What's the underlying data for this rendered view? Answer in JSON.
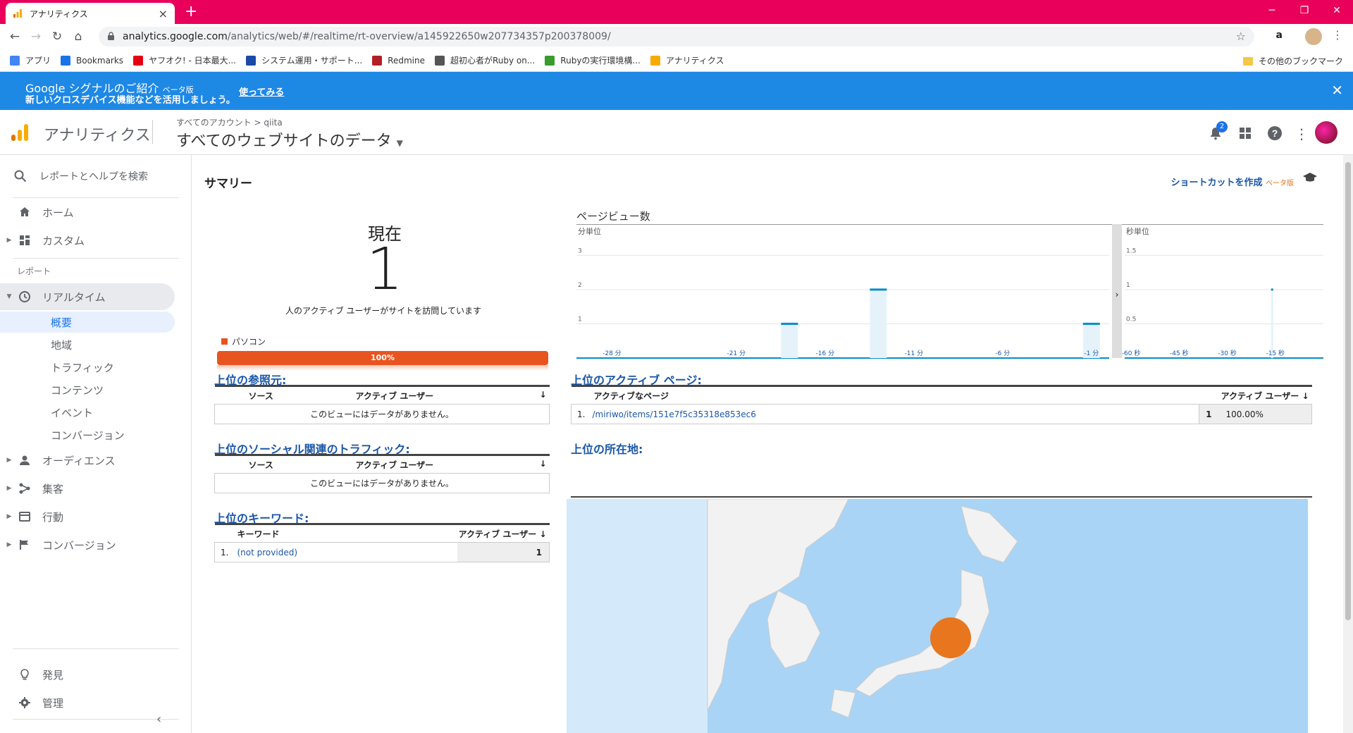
{
  "browser": {
    "tab_title": "アナリティクス",
    "url_host": "analytics.google.com",
    "url_path": "/analytics/web/#/realtime/rt-overview/a145922650w207734357p200378009/",
    "bookmarks": [
      {
        "label": "アプリ",
        "color": "#4285f4"
      },
      {
        "label": "Bookmarks",
        "color": "#1a73e8"
      },
      {
        "label": "ヤフオク! - 日本最大...",
        "color": "#e60012"
      },
      {
        "label": "システム運用・サポート...",
        "color": "#1a4aa8"
      },
      {
        "label": "Redmine",
        "color": "#b32024"
      },
      {
        "label": "超初心者がRuby on...",
        "color": "#555555"
      },
      {
        "label": "Rubyの実行環境構...",
        "color": "#3a9c2c"
      },
      {
        "label": "アナリティクス",
        "color": "#f9ab00"
      }
    ],
    "other_bookmarks": "その他のブックマーク"
  },
  "banner": {
    "title": "Google シグナルのご紹介",
    "beta": "ベータ版",
    "subtitle": "新しいクロスデバイス機能などを活用しましょう。",
    "action": "使ってみる"
  },
  "header": {
    "app_name": "アナリティクス",
    "breadcrumb": "すべてのアカウント > qiita",
    "view_name": "すべてのウェブサイトのデータ",
    "notification_count": "2"
  },
  "sidebar": {
    "search_placeholder": "レポートとヘルプを検索",
    "home": "ホーム",
    "custom": "カスタム",
    "reports_label": "レポート",
    "realtime": "リアルタイム",
    "realtime_sub": [
      "概要",
      "地域",
      "トラフィック",
      "コンテンツ",
      "イベント",
      "コンバージョン"
    ],
    "audience": "オーディエンス",
    "acquisition": "集客",
    "behavior": "行動",
    "conversions": "コンバージョン",
    "discover": "発見",
    "admin": "管理"
  },
  "main": {
    "title": "サマリー",
    "shortcut": "ショートカットを作成",
    "shortcut_beta": "ベータ版",
    "now_label": "現在",
    "now_value": "1",
    "now_desc": "人のアクティブ ユーザーがサイトを訪問しています",
    "device_legend": "パソコン",
    "device_percent": "100%",
    "device_color": "#e8541f",
    "pageviews_title": "ページビュー数",
    "per_minute_label": "分単位",
    "per_second_label": "秒単位",
    "referrers": {
      "title": "上位の参照元:",
      "col1": "ソース",
      "col2": "アクティブ ユーザー",
      "empty": "このビューにはデータがありません。"
    },
    "social": {
      "title": "上位のソーシャル関連のトラフィック:",
      "col1": "ソース",
      "col2": "アクティブ ユーザー",
      "empty": "このビューにはデータがありません。"
    },
    "keywords": {
      "title": "上位のキーワード:",
      "col1": "キーワード",
      "col2": "アクティブ ユーザー",
      "rows": [
        {
          "index": "1.",
          "keyword": "(not provided)",
          "users": "1"
        }
      ]
    },
    "pages": {
      "title": "上位のアクティブ ページ:",
      "col1": "アクティブなページ",
      "col2": "アクティブ ユーザー",
      "rows": [
        {
          "index": "1.",
          "page": "/miriwo/items/151e7f5c35318e853ec6",
          "users": "1",
          "percent": "100.00%"
        }
      ]
    },
    "locations": {
      "title": "上位の所在地:"
    }
  },
  "chart_data": [
    {
      "type": "bar",
      "title": "分単位",
      "x_ticks": [
        "-28 分",
        "-21 分",
        "-16 分",
        "-11 分",
        "-6 分",
        "-1 分"
      ],
      "y_ticks": [
        "1",
        "2",
        "3"
      ],
      "ylim": [
        0,
        3.5
      ],
      "xlim": [
        -30,
        0
      ],
      "x": [
        -18,
        -13,
        -1
      ],
      "values": [
        1,
        2,
        1
      ],
      "color": "#058dc7",
      "grid": true
    },
    {
      "type": "bar",
      "title": "秒単位",
      "x_ticks": [
        "-60 秒",
        "-45 秒",
        "-30 秒",
        "-15 秒"
      ],
      "y_ticks": [
        "0.5",
        "1",
        "1.5"
      ],
      "ylim": [
        0,
        1.75
      ],
      "xlim": [
        -62,
        0
      ],
      "x": [
        -16
      ],
      "values": [
        1
      ],
      "color": "#058dc7",
      "grid": true
    }
  ]
}
